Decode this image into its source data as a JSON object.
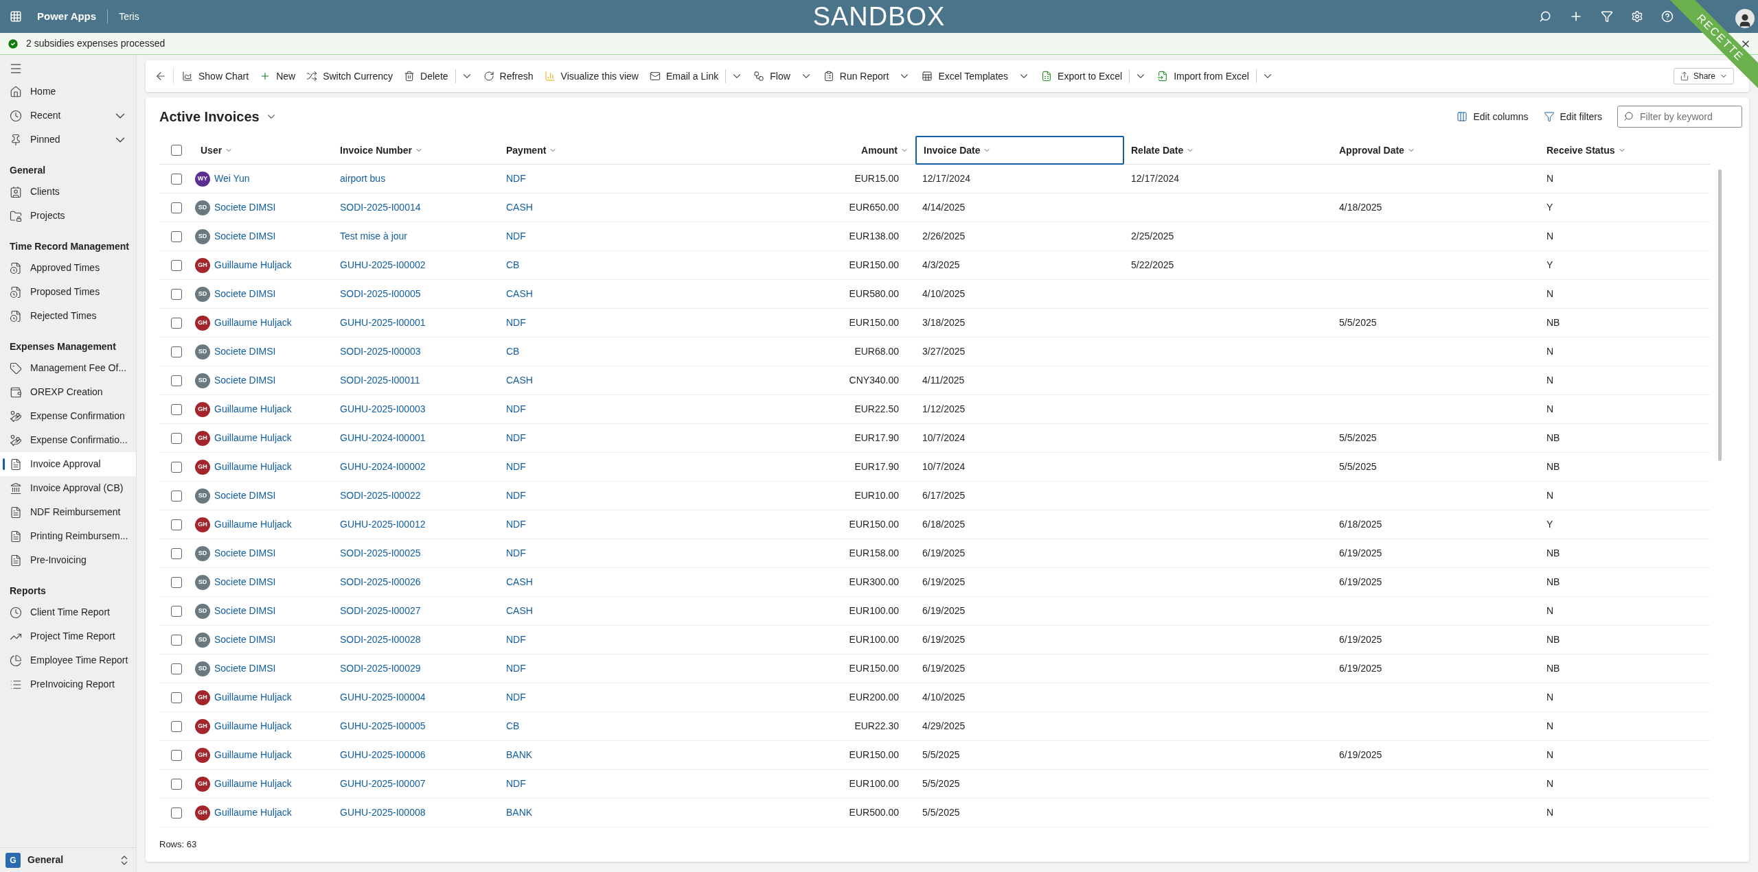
{
  "top_bar": {
    "app_name": "Power Apps",
    "environment": "Teris",
    "banner": "SANDBOX",
    "ribbon": "RECETTE"
  },
  "notification": {
    "message": "2 subsidies expenses processed"
  },
  "sidebar": {
    "top_items": [
      {
        "label": "Home",
        "selected": false
      },
      {
        "label": "Recent",
        "selected": false,
        "expanded": false
      },
      {
        "label": "Pinned",
        "selected": false,
        "expanded": false
      }
    ],
    "sections": [
      {
        "title": "General",
        "items": [
          {
            "label": "Clients",
            "selected": false
          },
          {
            "label": "Projects",
            "selected": false
          }
        ]
      },
      {
        "title": "Time Record Management",
        "items": [
          {
            "label": "Approved Times",
            "selected": false
          },
          {
            "label": "Proposed Times",
            "selected": false
          },
          {
            "label": "Rejected Times",
            "selected": false
          }
        ]
      },
      {
        "title": "Expenses Management",
        "items": [
          {
            "label": "Management Fee Of...",
            "selected": false
          },
          {
            "label": "OREXP Creation",
            "selected": false
          },
          {
            "label": "Expense Confirmation",
            "selected": false
          },
          {
            "label": "Expense Confirmatio...",
            "selected": false
          },
          {
            "label": "Invoice Approval",
            "selected": true
          },
          {
            "label": "Invoice Approval (CB)",
            "selected": false
          },
          {
            "label": "NDF Reimbursement",
            "selected": false
          },
          {
            "label": "Printing Reimbursem...",
            "selected": false
          },
          {
            "label": "Pre-Invoicing",
            "selected": false
          }
        ]
      },
      {
        "title": "Reports",
        "items": [
          {
            "label": "Client Time Report",
            "selected": false
          },
          {
            "label": "Project Time Report",
            "selected": false
          },
          {
            "label": "Employee Time Report",
            "selected": false
          },
          {
            "label": "PreInvoicing Report",
            "selected": false
          }
        ]
      }
    ],
    "footer": {
      "badge": "G",
      "label": "General"
    }
  },
  "toolbar": {
    "items": [
      {
        "label": "Show Chart",
        "kind": "plain"
      },
      {
        "label": "New",
        "kind": "plain"
      },
      {
        "label": "Switch Currency",
        "kind": "plain"
      },
      {
        "label": "Delete",
        "kind": "split"
      },
      {
        "label": "Refresh",
        "kind": "plain"
      },
      {
        "label": "Visualize this view",
        "kind": "plain"
      },
      {
        "label": "Email a Link",
        "kind": "split"
      },
      {
        "label": "Flow",
        "kind": "dropdown"
      },
      {
        "label": "Run Report",
        "kind": "dropdown"
      },
      {
        "label": "Excel Templates",
        "kind": "dropdown"
      },
      {
        "label": "Export to Excel",
        "kind": "split"
      },
      {
        "label": "Import from Excel",
        "kind": "split"
      }
    ],
    "share": "Share"
  },
  "view": {
    "title": "Active Invoices",
    "actions": [
      "Edit columns",
      "Edit filters"
    ],
    "search": {
      "placeholder": "Filter by keyword"
    }
  },
  "table": {
    "select_all": {
      "checked": false
    },
    "columns": [
      {
        "label": "User",
        "focused": false
      },
      {
        "label": "Invoice Number",
        "focused": false
      },
      {
        "label": "Payment",
        "focused": false
      },
      {
        "label": "Amount",
        "focused": false
      },
      {
        "label": "Invoice Date",
        "focused": true
      },
      {
        "label": "Relate Date",
        "focused": false
      },
      {
        "label": "Approval Date",
        "focused": false
      },
      {
        "label": "Receive Status",
        "focused": false
      }
    ],
    "rows": [
      {
        "checked": false,
        "avatar": {
          "initials": "WY",
          "color": "#5c2e91"
        },
        "cells": [
          "Wei Yun",
          "airport bus",
          "NDF",
          "EUR15.00",
          "12/17/2024",
          "12/17/2024",
          null,
          "N"
        ]
      },
      {
        "checked": false,
        "avatar": {
          "initials": "SD",
          "color": "#69797e"
        },
        "cells": [
          "Societe DIMSI",
          "SODI-2025-I00014",
          "CASH",
          "EUR650.00",
          "4/14/2025",
          null,
          "4/18/2025",
          "Y"
        ]
      },
      {
        "checked": false,
        "avatar": {
          "initials": "SD",
          "color": "#69797e"
        },
        "cells": [
          "Societe DIMSI",
          "Test mise à jour",
          "NDF",
          "EUR138.00",
          "2/26/2025",
          "2/25/2025",
          null,
          "N"
        ]
      },
      {
        "checked": false,
        "avatar": {
          "initials": "GH",
          "color": "#a4262c"
        },
        "cells": [
          "Guillaume Huljack",
          "GUHU-2025-I00002",
          "CB",
          "EUR150.00",
          "4/3/2025",
          "5/22/2025",
          null,
          "Y"
        ]
      },
      {
        "checked": false,
        "avatar": {
          "initials": "SD",
          "color": "#69797e"
        },
        "cells": [
          "Societe DIMSI",
          "SODI-2025-I00005",
          "CASH",
          "EUR580.00",
          "4/10/2025",
          null,
          null,
          "N"
        ]
      },
      {
        "checked": false,
        "avatar": {
          "initials": "GH",
          "color": "#a4262c"
        },
        "cells": [
          "Guillaume Huljack",
          "GUHU-2025-I00001",
          "NDF",
          "EUR150.00",
          "3/18/2025",
          null,
          "5/5/2025",
          "NB"
        ]
      },
      {
        "checked": false,
        "avatar": {
          "initials": "SD",
          "color": "#69797e"
        },
        "cells": [
          "Societe DIMSI",
          "SODI-2025-I00003",
          "CB",
          "EUR68.00",
          "3/27/2025",
          null,
          null,
          "N"
        ]
      },
      {
        "checked": false,
        "avatar": {
          "initials": "SD",
          "color": "#69797e"
        },
        "cells": [
          "Societe DIMSI",
          "SODI-2025-I00011",
          "CASH",
          "CNY340.00",
          "4/11/2025",
          null,
          null,
          "N"
        ]
      },
      {
        "checked": false,
        "avatar": {
          "initials": "GH",
          "color": "#a4262c"
        },
        "cells": [
          "Guillaume Huljack",
          "GUHU-2025-I00003",
          "NDF",
          "EUR22.50",
          "1/12/2025",
          null,
          null,
          "N"
        ]
      },
      {
        "checked": false,
        "avatar": {
          "initials": "GH",
          "color": "#a4262c"
        },
        "cells": [
          "Guillaume Huljack",
          "GUHU-2024-I00001",
          "NDF",
          "EUR17.90",
          "10/7/2024",
          null,
          "5/5/2025",
          "NB"
        ]
      },
      {
        "checked": false,
        "avatar": {
          "initials": "GH",
          "color": "#a4262c"
        },
        "cells": [
          "Guillaume Huljack",
          "GUHU-2024-I00002",
          "NDF",
          "EUR17.90",
          "10/7/2024",
          null,
          "5/5/2025",
          "NB"
        ]
      },
      {
        "checked": false,
        "avatar": {
          "initials": "SD",
          "color": "#69797e"
        },
        "cells": [
          "Societe DIMSI",
          "SODI-2025-I00022",
          "NDF",
          "EUR10.00",
          "6/17/2025",
          null,
          null,
          "N"
        ]
      },
      {
        "checked": false,
        "avatar": {
          "initials": "GH",
          "color": "#a4262c"
        },
        "cells": [
          "Guillaume Huljack",
          "GUHU-2025-I00012",
          "NDF",
          "EUR150.00",
          "6/18/2025",
          null,
          "6/18/2025",
          "Y"
        ]
      },
      {
        "checked": false,
        "avatar": {
          "initials": "SD",
          "color": "#69797e"
        },
        "cells": [
          "Societe DIMSI",
          "SODI-2025-I00025",
          "NDF",
          "EUR158.00",
          "6/19/2025",
          null,
          "6/19/2025",
          "NB"
        ]
      },
      {
        "checked": false,
        "avatar": {
          "initials": "SD",
          "color": "#69797e"
        },
        "cells": [
          "Societe DIMSI",
          "SODI-2025-I00026",
          "CASH",
          "EUR300.00",
          "6/19/2025",
          null,
          "6/19/2025",
          "NB"
        ]
      },
      {
        "checked": false,
        "avatar": {
          "initials": "SD",
          "color": "#69797e"
        },
        "cells": [
          "Societe DIMSI",
          "SODI-2025-I00027",
          "CASH",
          "EUR100.00",
          "6/19/2025",
          null,
          null,
          "N"
        ]
      },
      {
        "checked": false,
        "avatar": {
          "initials": "SD",
          "color": "#69797e"
        },
        "cells": [
          "Societe DIMSI",
          "SODI-2025-I00028",
          "NDF",
          "EUR100.00",
          "6/19/2025",
          null,
          "6/19/2025",
          "NB"
        ]
      },
      {
        "checked": false,
        "avatar": {
          "initials": "SD",
          "color": "#69797e"
        },
        "cells": [
          "Societe DIMSI",
          "SODI-2025-I00029",
          "NDF",
          "EUR150.00",
          "6/19/2025",
          null,
          "6/19/2025",
          "NB"
        ]
      },
      {
        "checked": false,
        "avatar": {
          "initials": "GH",
          "color": "#a4262c"
        },
        "cells": [
          "Guillaume Huljack",
          "GUHU-2025-I00004",
          "NDF",
          "EUR200.00",
          "4/10/2025",
          null,
          null,
          "N"
        ]
      },
      {
        "checked": false,
        "avatar": {
          "initials": "GH",
          "color": "#a4262c"
        },
        "cells": [
          "Guillaume Huljack",
          "GUHU-2025-I00005",
          "CB",
          "EUR22.30",
          "4/29/2025",
          null,
          null,
          "N"
        ]
      },
      {
        "checked": false,
        "avatar": {
          "initials": "GH",
          "color": "#a4262c"
        },
        "cells": [
          "Guillaume Huljack",
          "GUHU-2025-I00006",
          "BANK",
          "EUR150.00",
          "5/5/2025",
          null,
          "6/19/2025",
          "N"
        ]
      },
      {
        "checked": false,
        "avatar": {
          "initials": "GH",
          "color": "#a4262c"
        },
        "cells": [
          "Guillaume Huljack",
          "GUHU-2025-I00007",
          "NDF",
          "EUR100.00",
          "5/5/2025",
          null,
          null,
          "N"
        ]
      },
      {
        "checked": false,
        "avatar": {
          "initials": "GH",
          "color": "#a4262c"
        },
        "cells": [
          "Guillaume Huljack",
          "GUHU-2025-I00008",
          "BANK",
          "EUR500.00",
          "5/5/2025",
          null,
          null,
          "N"
        ]
      }
    ],
    "footer": "Rows: 63"
  }
}
